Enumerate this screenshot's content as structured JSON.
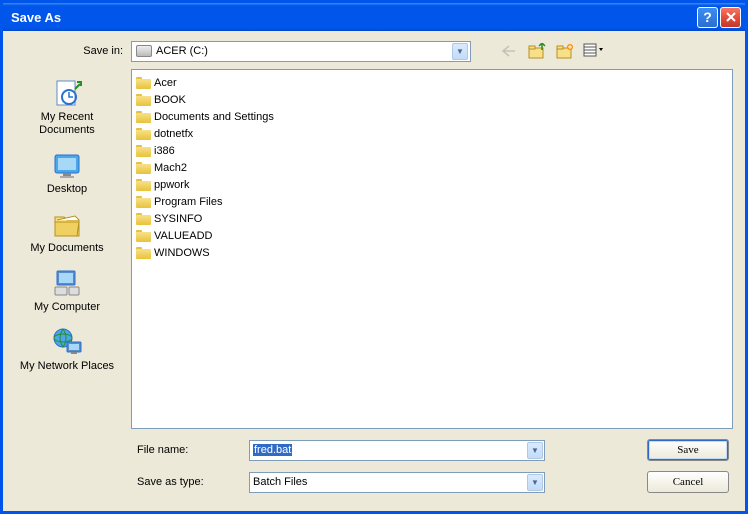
{
  "title": "Save As",
  "savein_label": "Save in:",
  "savein_value": "ACER (C:)",
  "places": [
    {
      "label": "My Recent Documents"
    },
    {
      "label": "Desktop"
    },
    {
      "label": "My Documents"
    },
    {
      "label": "My Computer"
    },
    {
      "label": "My Network Places"
    }
  ],
  "folders": [
    "Acer",
    "BOOK",
    "Documents and Settings",
    "dotnetfx",
    "i386",
    "Mach2",
    "ppwork",
    "Program Files",
    "SYSINFO",
    "VALUEADD",
    "WINDOWS"
  ],
  "filename_label": "File name:",
  "filename_value": "fred.bat",
  "filetype_label": "Save as type:",
  "filetype_value": "Batch Files",
  "save_btn": "Save",
  "cancel_btn": "Cancel"
}
